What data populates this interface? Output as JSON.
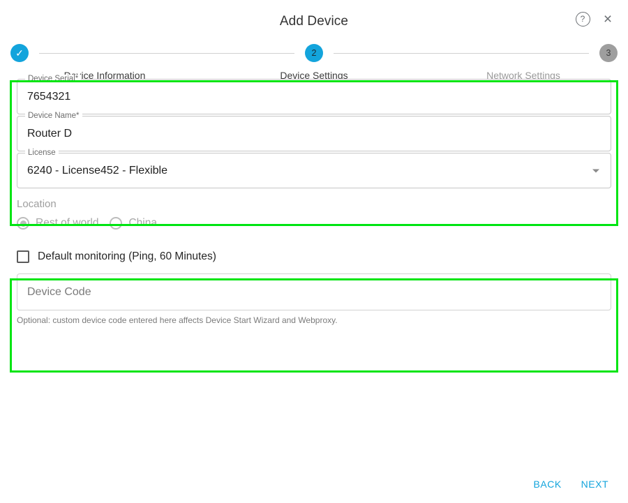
{
  "header": {
    "title": "Add Device",
    "help_icon": "help-circle-icon",
    "help_glyph": "?",
    "close_icon": "close-icon",
    "close_glyph": "×"
  },
  "stepper": {
    "steps": [
      {
        "number": "1",
        "label": "Device Information",
        "state": "done",
        "glyph": "✓"
      },
      {
        "number": "2",
        "label": "Device Settings",
        "state": "active",
        "glyph": "2"
      },
      {
        "number": "3",
        "label": "Network Settings",
        "state": "pending",
        "glyph": "3"
      }
    ],
    "active_color": "#13A4DC",
    "pending_color": "#9e9e9e"
  },
  "fields": {
    "device_serial": {
      "label": "Device Serial",
      "required_mark": "*",
      "value": "7654321"
    },
    "device_name": {
      "label": "Device Name",
      "required_mark": "*",
      "value": "Router D"
    },
    "license": {
      "label": "License",
      "value": "6240 - License452 - Flexible",
      "arrow_icon": "chevron-down-icon"
    }
  },
  "location": {
    "title": "Location",
    "options": [
      {
        "label": "Rest of world",
        "selected": true
      },
      {
        "label": "China",
        "selected": false
      }
    ],
    "disabled": true
  },
  "monitoring": {
    "checkbox_label": "Default monitoring (Ping, 60 Minutes)",
    "checked": false,
    "device_code_placeholder": "Device Code",
    "device_code_value": "",
    "helper_text": "Optional: custom device code entered here affects Device Start Wizard and Webproxy."
  },
  "footer": {
    "back_label": "BACK",
    "next_label": "NEXT",
    "link_color": "#13A4DC"
  },
  "highlights": {
    "color": "#00E512",
    "regions": [
      "device-fields-group",
      "monitoring-group"
    ]
  }
}
